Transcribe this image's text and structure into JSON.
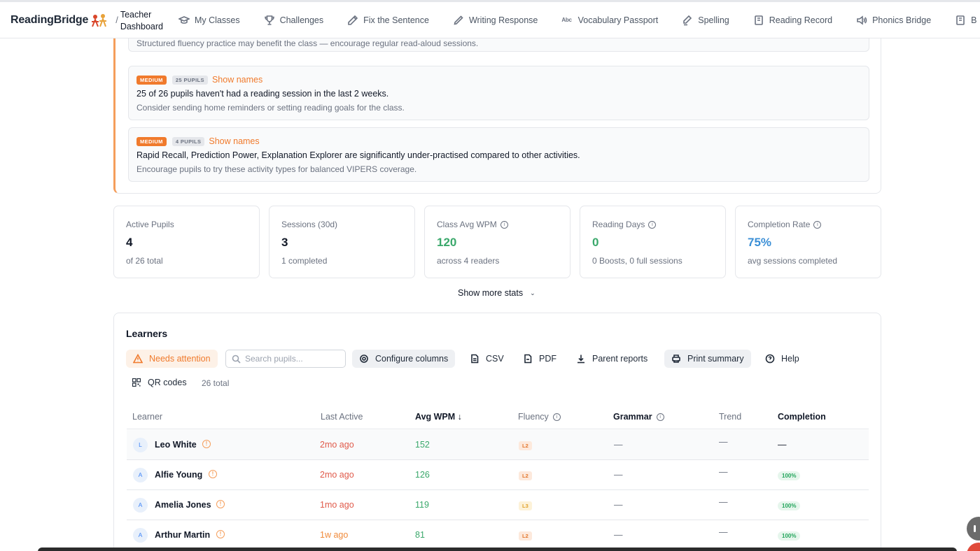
{
  "header": {
    "brand": "ReadingBridge",
    "separator": "/",
    "section_line1": "Teacher",
    "section_line2": "Dashboard",
    "nav": [
      {
        "label": "My Classes",
        "icon": "graduation-cap-icon"
      },
      {
        "label": "Challenges",
        "icon": "trophy-icon"
      },
      {
        "label": "Fix the Sentence",
        "icon": "pencil-icon"
      },
      {
        "label": "Writing Response",
        "icon": "pen-icon"
      },
      {
        "label": "Vocabulary Passport",
        "icon": "abc-icon"
      },
      {
        "label": "Spelling",
        "icon": "spell-check-icon"
      },
      {
        "label": "Reading Record",
        "icon": "book-icon"
      },
      {
        "label": "Phonics Bridge",
        "icon": "speaker-icon"
      },
      {
        "label": "B",
        "icon": "book-icon"
      }
    ]
  },
  "suggestions": {
    "top_hint": "Structured fluency practice may benefit the class — encourage regular read-aloud sessions.",
    "items": [
      {
        "priority": "MEDIUM",
        "pupils": "25 PUPILS",
        "show_names": "Show names",
        "message": "25 of 26 pupils haven't had a reading session in the last 2 weeks.",
        "hint": "Consider sending home reminders or setting reading goals for the class."
      },
      {
        "priority": "MEDIUM",
        "pupils": "4 PUPILS",
        "show_names": "Show names",
        "message": "Rapid Recall, Prediction Power, Explanation Explorer are significantly under-practised compared to other activities.",
        "hint": "Encourage pupils to try these activity types for balanced VIPERS coverage."
      }
    ]
  },
  "stats": [
    {
      "label": "Active Pupils",
      "value": "4",
      "sub": "of 26 total",
      "info": false,
      "color": "#111827"
    },
    {
      "label": "Sessions (30d)",
      "value": "3",
      "sub": "1 completed",
      "info": false,
      "color": "#111827"
    },
    {
      "label": "Class Avg WPM",
      "value": "120",
      "sub": "across 4 readers",
      "info": true,
      "color": "#3aa86b"
    },
    {
      "label": "Reading Days",
      "value": "0",
      "sub": "0 Boosts, 0 full sessions",
      "info": true,
      "color": "#3aa86b"
    },
    {
      "label": "Completion Rate",
      "value": "75%",
      "sub": "avg sessions completed",
      "info": true,
      "color": "#3b8fd6"
    }
  ],
  "show_more": "Show more stats",
  "learners": {
    "title": "Learners",
    "toolbar": {
      "needs_attention": "Needs attention",
      "search_placeholder": "Search pupils...",
      "configure": "Configure columns",
      "csv": "CSV",
      "pdf": "PDF",
      "parent_reports": "Parent reports",
      "print_summary": "Print summary",
      "help": "Help",
      "qr_codes": "QR codes",
      "total": "26 total"
    },
    "columns": {
      "learner": "Learner",
      "last_active": "Last Active",
      "avg_wpm": "Avg WPM ↓",
      "fluency": "Fluency",
      "grammar": "Grammar",
      "trend": "Trend",
      "completion": "Completion"
    },
    "rows": [
      {
        "initial": "L",
        "name": "Leo White",
        "last_active": "2mo ago",
        "last_color": "#e05a4a",
        "wpm": "152",
        "level": "L2",
        "level_bg": "#fde9dc",
        "level_fg": "#e3772e",
        "grammar": "—",
        "trend": "—",
        "completion": "—",
        "has_completion": false
      },
      {
        "initial": "A",
        "name": "Alfie Young",
        "last_active": "2mo ago",
        "last_color": "#e05a4a",
        "wpm": "126",
        "level": "L2",
        "level_bg": "#fde9dc",
        "level_fg": "#e3772e",
        "grammar": "—",
        "trend": "—",
        "completion": "100%",
        "has_completion": true
      },
      {
        "initial": "A",
        "name": "Amelia Jones",
        "last_active": "1mo ago",
        "last_color": "#e05a4a",
        "wpm": "119",
        "level": "L3",
        "level_bg": "#fdf2d8",
        "level_fg": "#e0a12a",
        "grammar": "—",
        "trend": "—",
        "completion": "100%",
        "has_completion": true
      },
      {
        "initial": "A",
        "name": "Arthur Martin",
        "last_active": "1w ago",
        "last_color": "#f08a3a",
        "wpm": "81",
        "level": "L2",
        "level_bg": "#fde9dc",
        "level_fg": "#e3772e",
        "grammar": "—",
        "trend": "—",
        "completion": "100%",
        "has_completion": true
      }
    ]
  },
  "colors": {
    "accent_orange": "#f07a2c",
    "wpm_green": "#3aa86b",
    "completion_blue": "#3b8fd6"
  }
}
